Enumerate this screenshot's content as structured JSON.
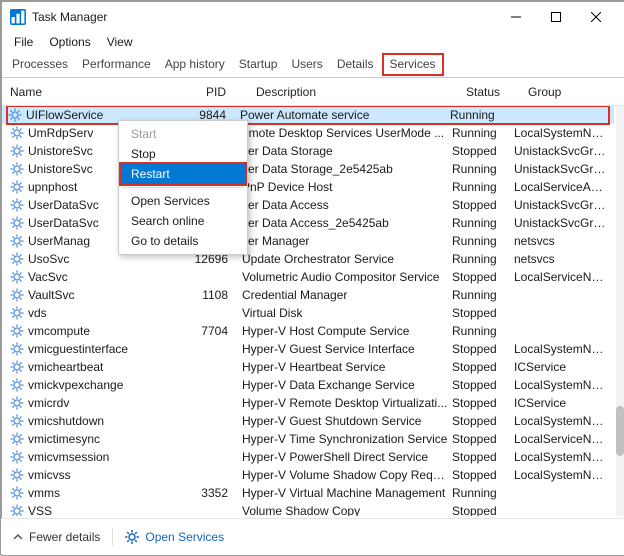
{
  "window": {
    "title": "Task Manager"
  },
  "menu": {
    "file": "File",
    "options": "Options",
    "view": "View"
  },
  "tabs": {
    "processes": "Processes",
    "performance": "Performance",
    "app_history": "App history",
    "startup": "Startup",
    "users": "Users",
    "details": "Details",
    "services": "Services"
  },
  "columns": {
    "name": "Name",
    "pid": "PID",
    "description": "Description",
    "status": "Status",
    "group": "Group"
  },
  "context_menu": {
    "start": "Start",
    "stop": "Stop",
    "restart": "Restart",
    "open_services": "Open Services",
    "search_online": "Search online",
    "go_to_details": "Go to details"
  },
  "services": [
    {
      "name": "UIFlowService",
      "pid": "9844",
      "description": "Power Automate service",
      "status": "Running",
      "group": ""
    },
    {
      "name": "UmRdpServ",
      "pid": "",
      "description": "emote Desktop Services UserMode ...",
      "status": "Running",
      "group": "LocalSystemNe..."
    },
    {
      "name": "UnistoreSvc",
      "pid": "",
      "description": "ser Data Storage",
      "status": "Stopped",
      "group": "UnistackSvcGro..."
    },
    {
      "name": "UnistoreSvc",
      "pid": "",
      "description": "ser Data Storage_2e5425ab",
      "status": "Running",
      "group": "UnistackSvcGro..."
    },
    {
      "name": "upnphost",
      "pid": "",
      "description": "PnP Device Host",
      "status": "Running",
      "group": "LocalServiceAn..."
    },
    {
      "name": "UserDataSvc",
      "pid": "",
      "description": "ser Data Access",
      "status": "Stopped",
      "group": "UnistackSvcGro..."
    },
    {
      "name": "UserDataSvc",
      "pid": "",
      "description": "ser Data Access_2e5425ab",
      "status": "Running",
      "group": "UnistackSvcGro..."
    },
    {
      "name": "UserManag",
      "pid": "",
      "description": "ser Manager",
      "status": "Running",
      "group": "netsvcs"
    },
    {
      "name": "UsoSvc",
      "pid": "12696",
      "description": "Update Orchestrator Service",
      "status": "Running",
      "group": "netsvcs"
    },
    {
      "name": "VacSvc",
      "pid": "",
      "description": "Volumetric Audio Compositor Service",
      "status": "Stopped",
      "group": "LocalServiceNe..."
    },
    {
      "name": "VaultSvc",
      "pid": "1108",
      "description": "Credential Manager",
      "status": "Running",
      "group": ""
    },
    {
      "name": "vds",
      "pid": "",
      "description": "Virtual Disk",
      "status": "Stopped",
      "group": ""
    },
    {
      "name": "vmcompute",
      "pid": "7704",
      "description": "Hyper-V Host Compute Service",
      "status": "Running",
      "group": ""
    },
    {
      "name": "vmicguestinterface",
      "pid": "",
      "description": "Hyper-V Guest Service Interface",
      "status": "Stopped",
      "group": "LocalSystemNe..."
    },
    {
      "name": "vmicheartbeat",
      "pid": "",
      "description": "Hyper-V Heartbeat Service",
      "status": "Stopped",
      "group": "ICService"
    },
    {
      "name": "vmickvpexchange",
      "pid": "",
      "description": "Hyper-V Data Exchange Service",
      "status": "Stopped",
      "group": "LocalSystemNe..."
    },
    {
      "name": "vmicrdv",
      "pid": "",
      "description": "Hyper-V Remote Desktop Virtualizati...",
      "status": "Stopped",
      "group": "ICService"
    },
    {
      "name": "vmicshutdown",
      "pid": "",
      "description": "Hyper-V Guest Shutdown Service",
      "status": "Stopped",
      "group": "LocalSystemNe..."
    },
    {
      "name": "vmictimesync",
      "pid": "",
      "description": "Hyper-V Time Synchronization Service",
      "status": "Stopped",
      "group": "LocalServiceNe..."
    },
    {
      "name": "vmicvmsession",
      "pid": "",
      "description": "Hyper-V PowerShell Direct Service",
      "status": "Stopped",
      "group": "LocalSystemNe..."
    },
    {
      "name": "vmicvss",
      "pid": "",
      "description": "Hyper-V Volume Shadow Copy Reque...",
      "status": "Stopped",
      "group": "LocalSystemNe..."
    },
    {
      "name": "vmms",
      "pid": "3352",
      "description": "Hyper-V Virtual Machine Management",
      "status": "Running",
      "group": ""
    },
    {
      "name": "VSS",
      "pid": "",
      "description": "Volume Shadow Copy",
      "status": "Stopped",
      "group": ""
    }
  ],
  "bottom": {
    "fewer_details": "Fewer details",
    "open_services": "Open Services"
  }
}
